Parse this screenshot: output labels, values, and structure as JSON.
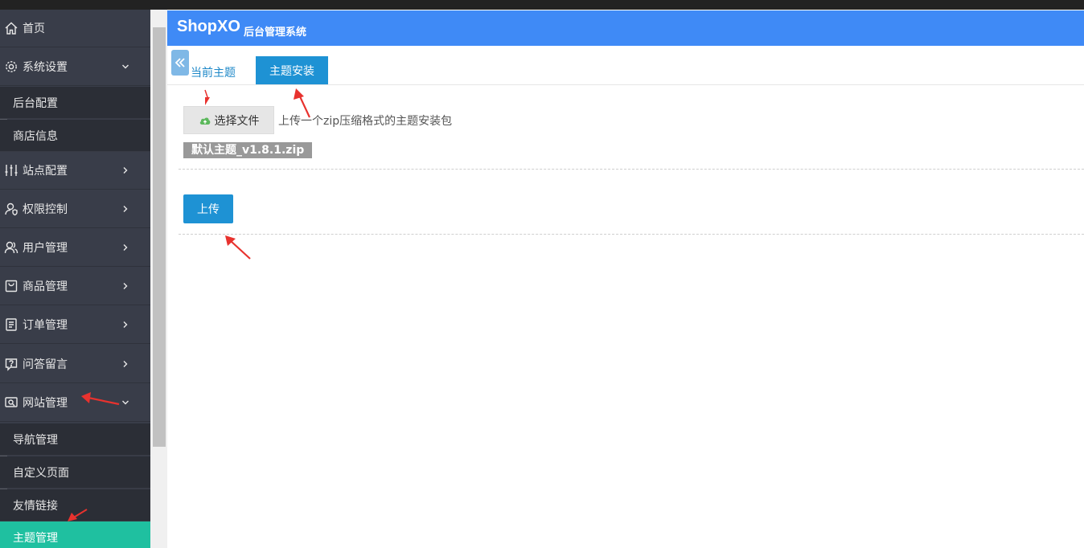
{
  "header": {
    "brand": "ShopXO",
    "subtitle": "后台管理系统",
    "color": "#3f8af6"
  },
  "sidebar": {
    "items": [
      {
        "label": "首页",
        "icon": "home-icon"
      },
      {
        "label": "系统设置",
        "icon": "gear-icon",
        "expanded": true
      },
      {
        "label": "站点配置",
        "icon": "sliders-icon"
      },
      {
        "label": "权限控制",
        "icon": "user-shield-icon"
      },
      {
        "label": "用户管理",
        "icon": "users-icon"
      },
      {
        "label": "商品管理",
        "icon": "bag-icon"
      },
      {
        "label": "订单管理",
        "icon": "clipboard-icon"
      },
      {
        "label": "问答留言",
        "icon": "question-icon"
      },
      {
        "label": "网站管理",
        "icon": "site-icon",
        "expanded": true
      }
    ],
    "system_sub": [
      "后台配置",
      "商店信息"
    ],
    "site_sub": [
      "导航管理",
      "自定义页面",
      "友情链接",
      "主题管理"
    ],
    "active_color": "#1fc0a0"
  },
  "tabs": {
    "current": "当前主题",
    "install": "主题安装"
  },
  "form": {
    "file_button": "选择文件",
    "hint": "上传一个zip压缩格式的主题安装包",
    "filename": "默认主题_v1.8.1.zip",
    "upload": "上传"
  }
}
